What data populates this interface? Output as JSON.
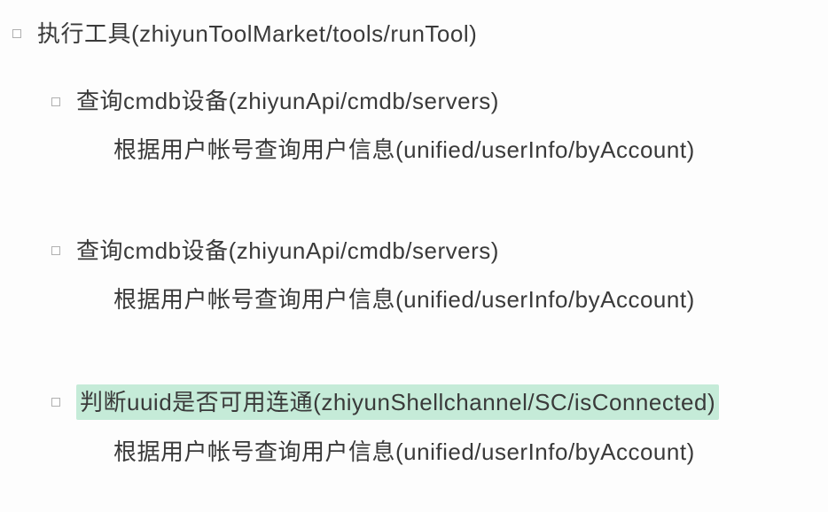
{
  "items": [
    {
      "level": 0,
      "bullet": true,
      "highlight": false,
      "label": "执行工具(zhiyunToolMarket/tools/runTool)"
    },
    {
      "level": 1,
      "bullet": true,
      "highlight": false,
      "label": "查询cmdb设备(zhiyunApi/cmdb/servers)"
    },
    {
      "level": 2,
      "bullet": false,
      "highlight": false,
      "label": "根据用户帐号查询用户信息(unified/userInfo/byAccount)"
    },
    {
      "level": 1,
      "bullet": true,
      "highlight": false,
      "label": "查询cmdb设备(zhiyunApi/cmdb/servers)"
    },
    {
      "level": 2,
      "bullet": false,
      "highlight": false,
      "label": "根据用户帐号查询用户信息(unified/userInfo/byAccount)"
    },
    {
      "level": 1,
      "bullet": true,
      "highlight": true,
      "label": "判断uuid是否可用连通(zhiyunShellchannel/SC/isConnected)"
    },
    {
      "level": 2,
      "bullet": false,
      "highlight": false,
      "label": "根据用户帐号查询用户信息(unified/userInfo/byAccount)"
    }
  ]
}
